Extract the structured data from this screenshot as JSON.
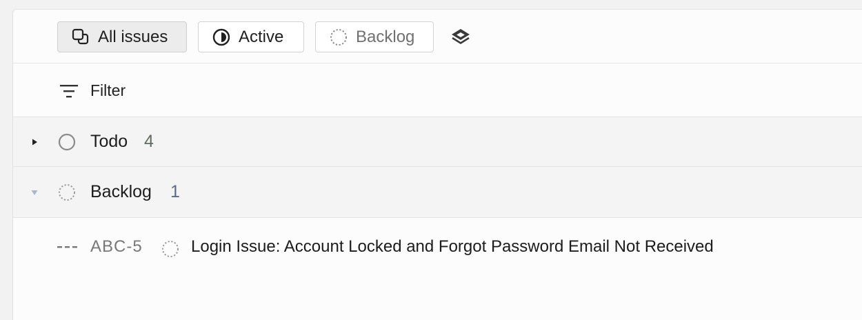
{
  "views": [
    {
      "label": "All issues",
      "icon": "copy-icon",
      "selected": true
    },
    {
      "label": "Active",
      "icon": "half-circle-icon",
      "selected": false
    },
    {
      "label": "Backlog",
      "icon": "dotted-circle-icon",
      "selected": false
    }
  ],
  "layers_icon": "layers-icon",
  "filter": {
    "label": "Filter",
    "icon": "filter-icon"
  },
  "groups": [
    {
      "label": "Todo",
      "count": "4",
      "icon": "empty-circle-icon",
      "expanded": false
    },
    {
      "label": "Backlog",
      "count": "1",
      "icon": "dotted-circle-icon",
      "expanded": true
    }
  ],
  "issues": [
    {
      "priority_icon": "no-priority-icon",
      "id": "ABC-5",
      "status_icon": "dotted-circle-icon",
      "title": "Login Issue: Account Locked and Forgot Password Email Not Received"
    }
  ]
}
